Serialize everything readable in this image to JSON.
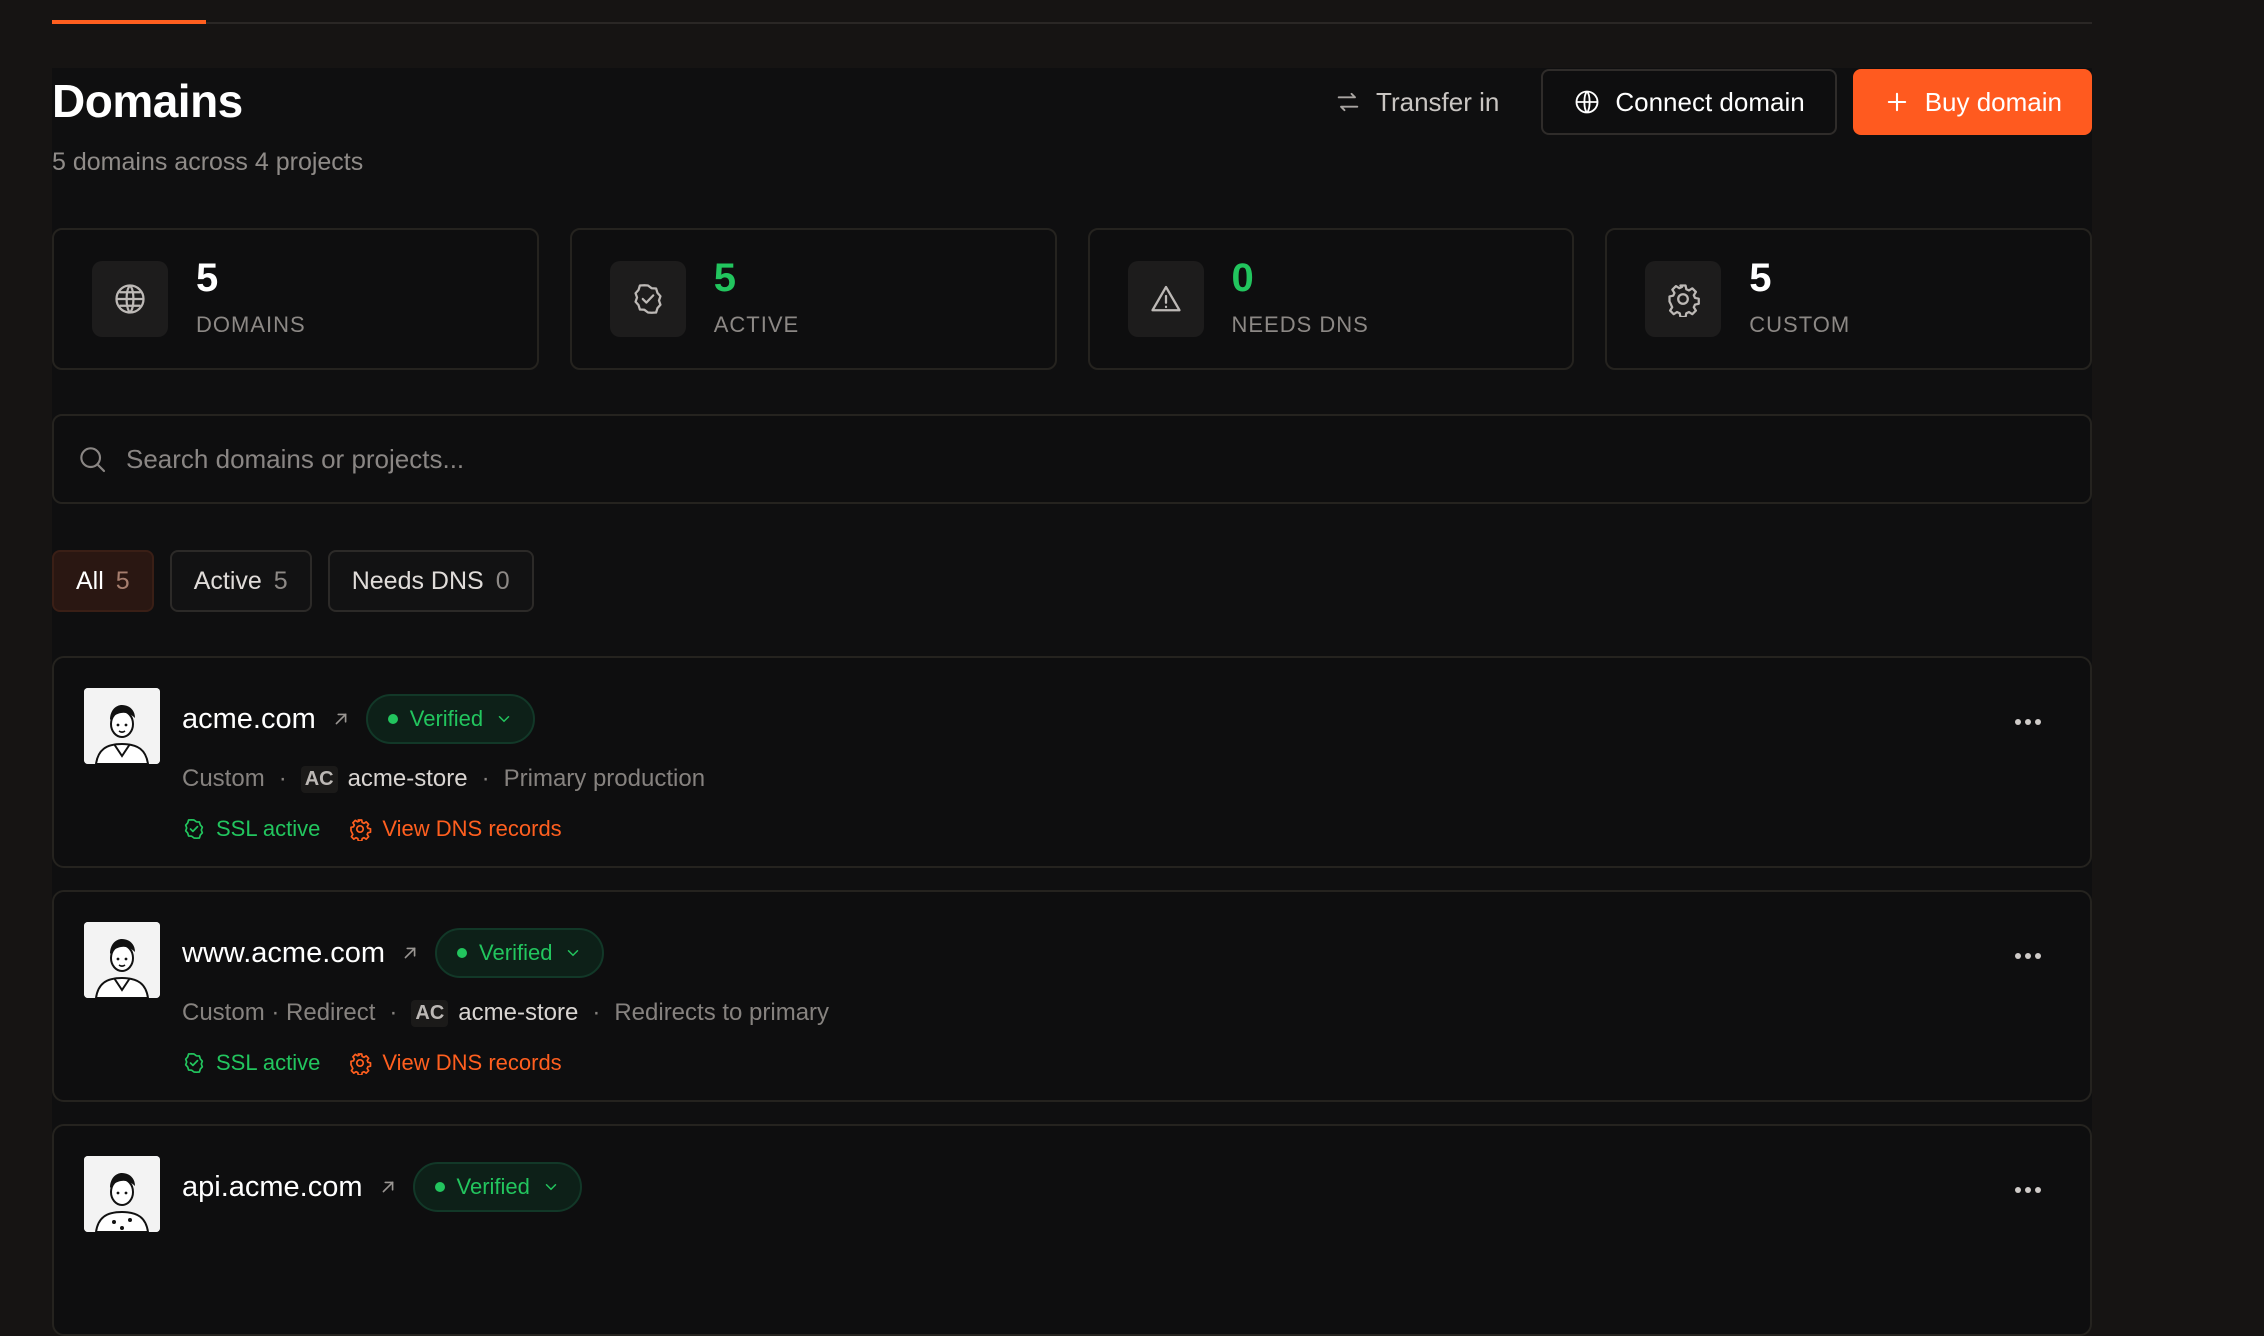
{
  "header": {
    "title": "Domains",
    "subtitle": "5 domains across 4 projects",
    "transfer_label": "Transfer in",
    "connect_label": "Connect domain",
    "buy_label": "Buy domain"
  },
  "stats": [
    {
      "value": "5",
      "label": "DOMAINS",
      "icon": "globe-icon"
    },
    {
      "value": "5",
      "label": "ACTIVE",
      "icon": "badge-check-icon",
      "color": "#22c55e"
    },
    {
      "value": "0",
      "label": "NEEDS DNS",
      "icon": "warning-icon",
      "color": "#22c55e"
    },
    {
      "value": "5",
      "label": "CUSTOM",
      "icon": "gear-icon"
    }
  ],
  "search": {
    "placeholder": "Search domains or projects..."
  },
  "filters": [
    {
      "label": "All",
      "count": "5"
    },
    {
      "label": "Active",
      "count": "5"
    },
    {
      "label": "Needs DNS",
      "count": "0"
    }
  ],
  "domains": [
    {
      "name": "acme.com",
      "status": "Verified",
      "type": "Custom",
      "project_initials": "AC",
      "project": "acme-store",
      "note": "Primary production",
      "ssl": "SSL active",
      "dns_link": "View DNS records"
    },
    {
      "name": "www.acme.com",
      "status": "Verified",
      "type": "Custom · Redirect",
      "project_initials": "AC",
      "project": "acme-store",
      "note": "Redirects to primary",
      "ssl": "SSL active",
      "dns_link": "View DNS records"
    },
    {
      "name": "api.acme.com",
      "status": "Verified"
    }
  ],
  "colors": {
    "accent": "#ff5a1f",
    "success": "#22c55e"
  }
}
